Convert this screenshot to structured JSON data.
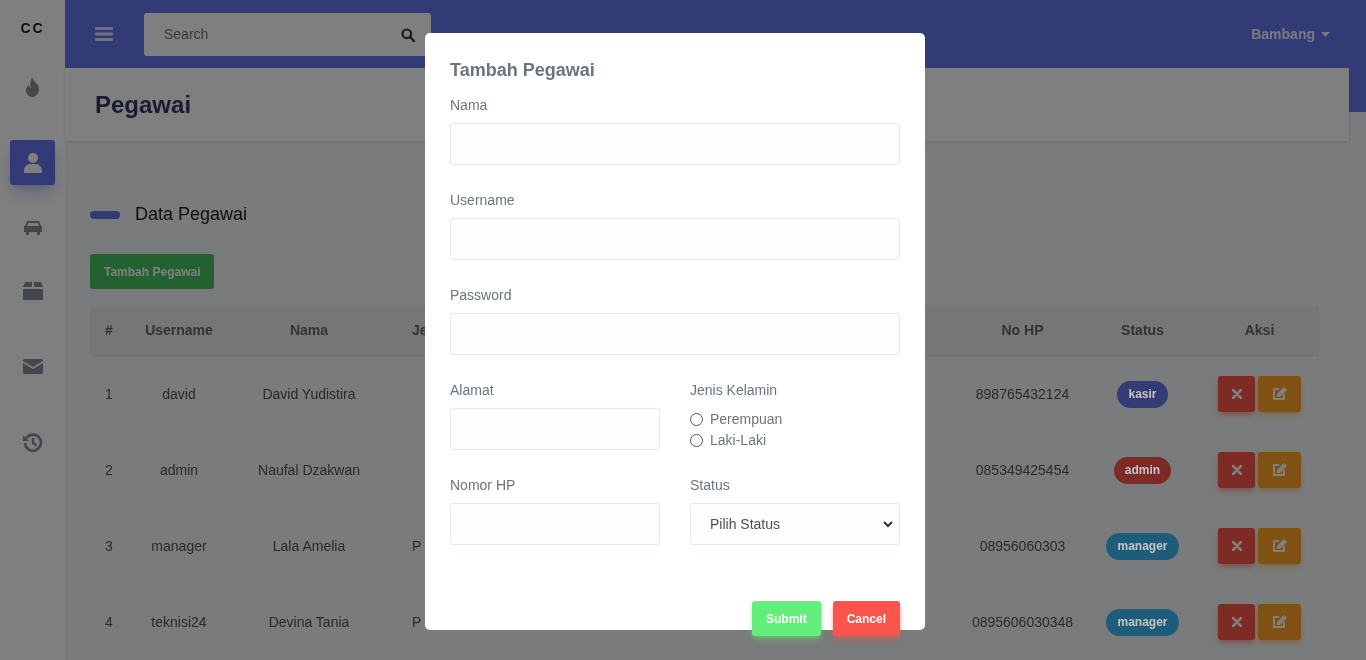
{
  "sidebar": {
    "logo": "CC",
    "items": [
      {
        "selected": false
      },
      {
        "selected": true
      },
      {
        "selected": false
      },
      {
        "selected": false
      },
      {
        "selected": false
      },
      {
        "selected": false
      }
    ]
  },
  "navbar": {
    "search": {
      "placeholder": "Search"
    },
    "user": "Bambang"
  },
  "page_title": "Pegawai",
  "section": {
    "title": "Data Pegawai",
    "add_button": "Tambah Pegawai"
  },
  "table": {
    "columns": [
      "#",
      "Username",
      "Nama",
      "Je",
      "No HP",
      "Status",
      "Aksi"
    ],
    "rows": [
      {
        "number": "1",
        "username": "david",
        "nama": "David Yudistira",
        "no_hp": "898765432124",
        "status": {
          "label": "kasir",
          "color": "#343c78"
        }
      },
      {
        "number": "2",
        "username": "admin",
        "nama": "Naufal Dzakwan",
        "no_hp": "085349425454",
        "status": {
          "label": "admin",
          "color": "#7e2a26"
        }
      },
      {
        "number": "3",
        "username": "manager",
        "nama": "Lala Amelia",
        "column_4": "P",
        "no_hp": "08956060303",
        "status": {
          "label": "manager",
          "color": "#1d5d7a"
        }
      },
      {
        "number": "4",
        "username": "teknisi24",
        "nama": "Devina Tania",
        "column_4": "P",
        "no_hp": "0895606030348",
        "status": {
          "label": "manager",
          "color": "#1d5d7a"
        }
      }
    ]
  },
  "modal": {
    "title": "Tambah Pegawai",
    "fields": [
      {
        "kind": "text",
        "label": "Nama"
      },
      {
        "kind": "text",
        "label": "Username"
      },
      {
        "kind": "text",
        "label": "Password"
      }
    ],
    "side_by_side_fields": [
      {
        "kind": "text",
        "label": "Alamat"
      },
      {
        "kind": "radio",
        "label": "Jenis Kelamin",
        "options": [
          {
            "label": "Perempuan",
            "selected": false
          },
          {
            "label": "Laki-Laki",
            "selected": false
          }
        ]
      },
      {
        "kind": "text",
        "label": "Nomor HP"
      },
      {
        "kind": "select",
        "label": "Status",
        "value": "Pilih Status"
      }
    ],
    "buttons": [
      {
        "kind": "submit",
        "label": "Submit"
      },
      {
        "kind": "cancel",
        "label": "Cancel"
      }
    ]
  }
}
